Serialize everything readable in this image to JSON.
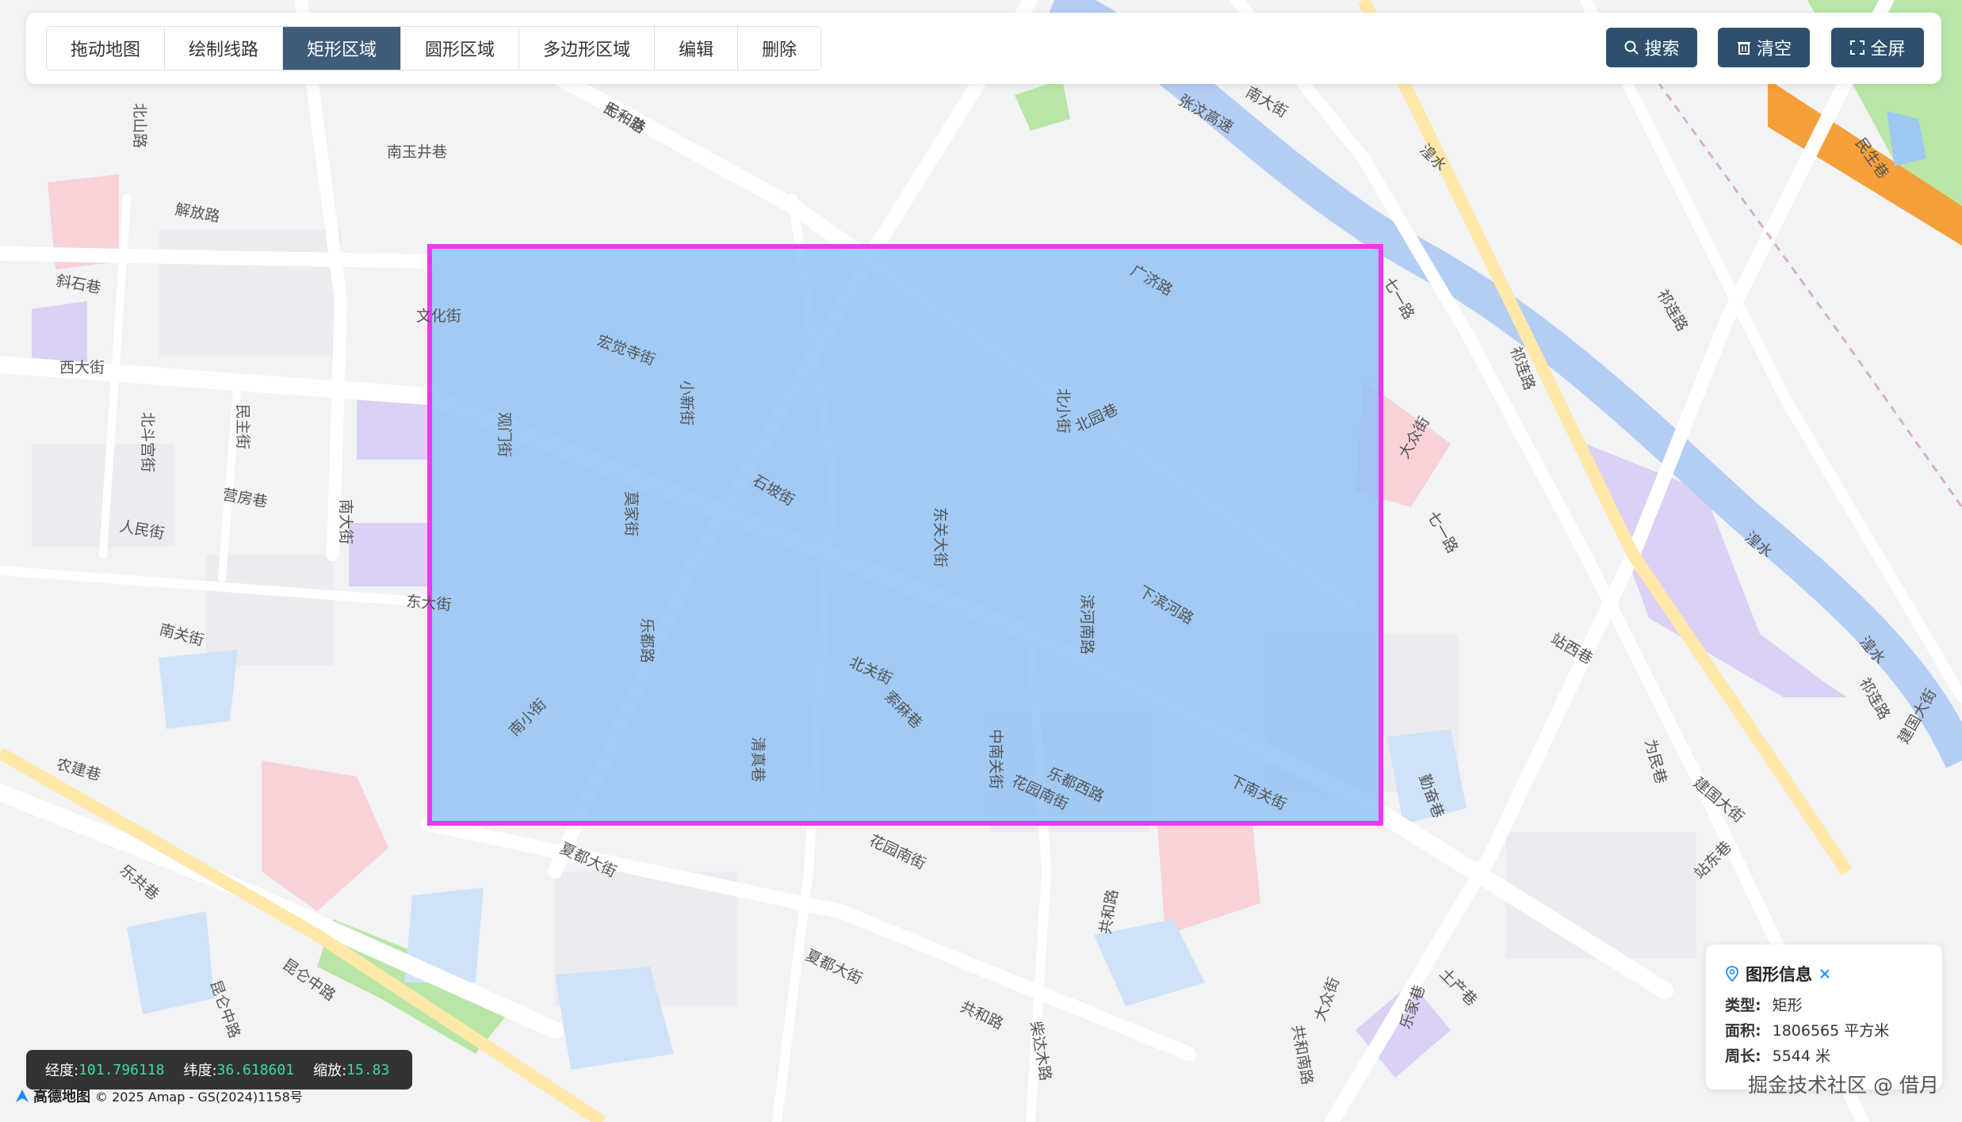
{
  "toolbar": {
    "tools": [
      {
        "label": "拖动地图",
        "active": false
      },
      {
        "label": "绘制线路",
        "active": false
      },
      {
        "label": "矩形区域",
        "active": true
      },
      {
        "label": "圆形区域",
        "active": false
      },
      {
        "label": "多边形区域",
        "active": false
      },
      {
        "label": "编辑",
        "active": false
      },
      {
        "label": "删除",
        "active": false
      }
    ],
    "search_label": "搜索",
    "clear_label": "清空",
    "fullscreen_label": "全屏"
  },
  "coords": {
    "lng_label": "经度:",
    "lng_value": "101.796118",
    "lat_label": "纬度:",
    "lat_value": "36.618601",
    "zoom_label": "缩放:",
    "zoom_value": "15.83"
  },
  "attribution": {
    "logo_text": "高德地图",
    "copyright": "© 2025 Amap - GS(2024)1158号"
  },
  "info": {
    "title": "图形信息",
    "type_label": "类型:",
    "type_value": "矩形",
    "area_label": "面积:",
    "area_value": "1806565 平方米",
    "perimeter_label": "周长:",
    "perimeter_value": "5544 米"
  },
  "watermark": "掘金技术社区 @ 借月",
  "map_labels": [
    "七一路",
    "南玉井巷",
    "北山路",
    "解放路",
    "斜石巷",
    "西大街",
    "北斗宫街",
    "民主街",
    "营房巷",
    "人民街",
    "南大街",
    "南关街",
    "农建巷",
    "文化街",
    "东大街",
    "宏觉寺街",
    "小新街",
    "观门街",
    "莫家街",
    "石坡街",
    "东关大街",
    "北小街",
    "北园巷",
    "广济路",
    "七一路",
    "下滨河路",
    "滨河南路",
    "北关街",
    "索麻巷",
    "中南关街",
    "清真巷",
    "乐都路",
    "南小街",
    "花园南街",
    "花园南街",
    "夏都大街",
    "夏都大街",
    "乐都西路",
    "下南关街",
    "大众街",
    "共和路",
    "共和路",
    "乐共巷",
    "昆仑中路",
    "昆仑中路",
    "南大街",
    "湟水",
    "湟水",
    "湟水",
    "祁连路",
    "祁连路",
    "祁连路",
    "站西巷",
    "为民巷",
    "建国大街",
    "建国大街",
    "站东巷",
    "土产巷",
    "勤奋巷",
    "大众街",
    "乐家巷",
    "共和南路",
    "柴达木路",
    "民生巷",
    "张汶高速",
    "七一路",
    "民和巷"
  ],
  "colors": {
    "toolbar_active": "#3f5c7b",
    "action_button": "#2e506e",
    "rectangle_fill": "#8fc1f4",
    "rectangle_stroke": "#ee37ee",
    "coord_value": "#3ddc97"
  }
}
